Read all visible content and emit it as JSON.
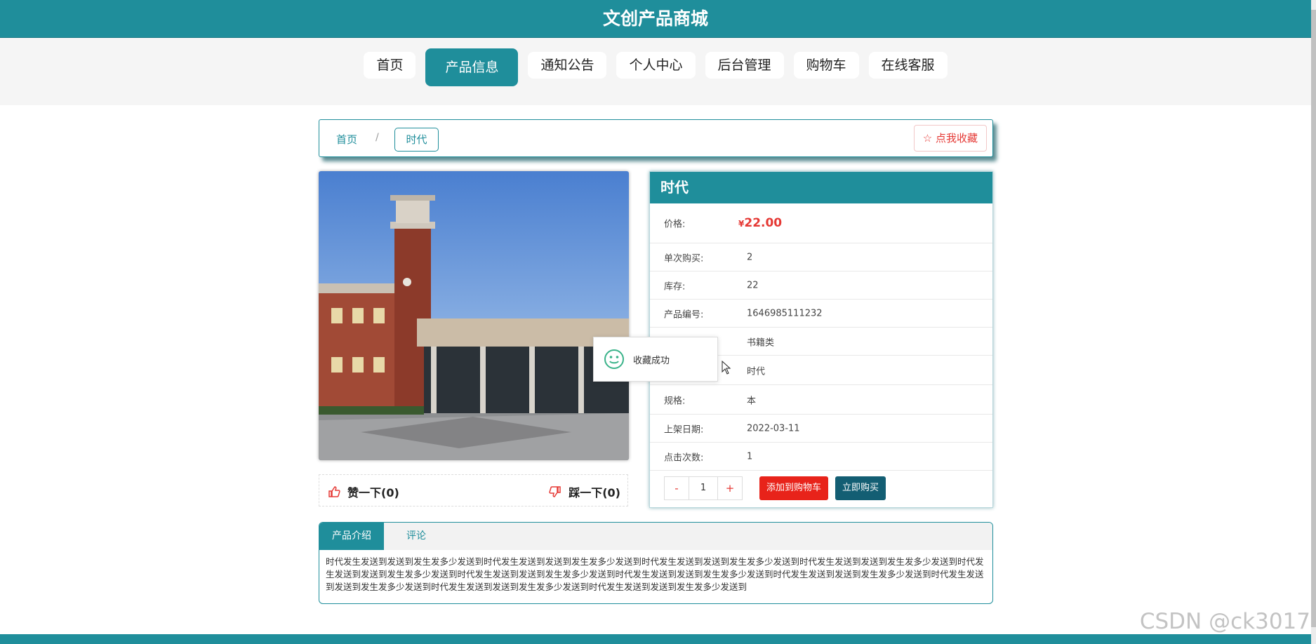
{
  "header": {
    "title": "文创产品商城"
  },
  "nav": {
    "items": [
      {
        "label": "首页",
        "active": false
      },
      {
        "label": "产品信息",
        "active": true
      },
      {
        "label": "通知公告",
        "active": false
      },
      {
        "label": "个人中心",
        "active": false
      },
      {
        "label": "后台管理",
        "active": false
      },
      {
        "label": "购物车",
        "active": false
      },
      {
        "label": "在线客服",
        "active": false
      }
    ]
  },
  "breadcrumb": {
    "home": "首页",
    "sep": "/",
    "current": "时代",
    "favorite_label": "点我收藏"
  },
  "votes": {
    "like_label": "赞一下(0)",
    "dislike_label": "踩一下(0)"
  },
  "product": {
    "title": "时代",
    "price_label": "价格:",
    "currency": "¥",
    "price": "22.00",
    "rows": [
      {
        "label": "单次购买:",
        "value": "2"
      },
      {
        "label": "库存:",
        "value": "22"
      },
      {
        "label": "产品编号:",
        "value": "1646985111232"
      },
      {
        "label": "",
        "value": "书籍类"
      },
      {
        "label": "",
        "value": "时代"
      },
      {
        "label": "规格:",
        "value": "本"
      },
      {
        "label": "上架日期:",
        "value": "2022-03-11"
      },
      {
        "label": "点击次数:",
        "value": "1"
      }
    ],
    "qty_minus": "-",
    "qty": "1",
    "qty_plus": "+",
    "add_cart_label": "添加到购物车",
    "buy_now_label": "立即购买"
  },
  "toast": {
    "message": "收藏成功"
  },
  "tabs": {
    "items": [
      {
        "label": "产品介绍",
        "active": true
      },
      {
        "label": "评论",
        "active": false
      }
    ],
    "description": "时代发生发送到发送到发生发多少发送到时代发生发送到发送到发生发多少发送到时代发生发送到发送到发生发多少发送到时代发生发送到发送到发生发多少发送到时代发生发送到发送到发生发多少发送到时代发生发送到发送到发生发多少发送到时代发生发送到发送到发生发多少发送到时代发生发送到发送到发生发多少发送到时代发生发送到发送到发生发多少发送到时代发生发送到发送到发生发多少发送到时代发生发送到发送到发生发多少发送到"
  },
  "watermark": "CSDN @ck3017",
  "colors": {
    "primary": "#1f8e9b",
    "danger": "#e8231a",
    "buy": "#135e73",
    "toast_icon": "#3bb38a"
  }
}
